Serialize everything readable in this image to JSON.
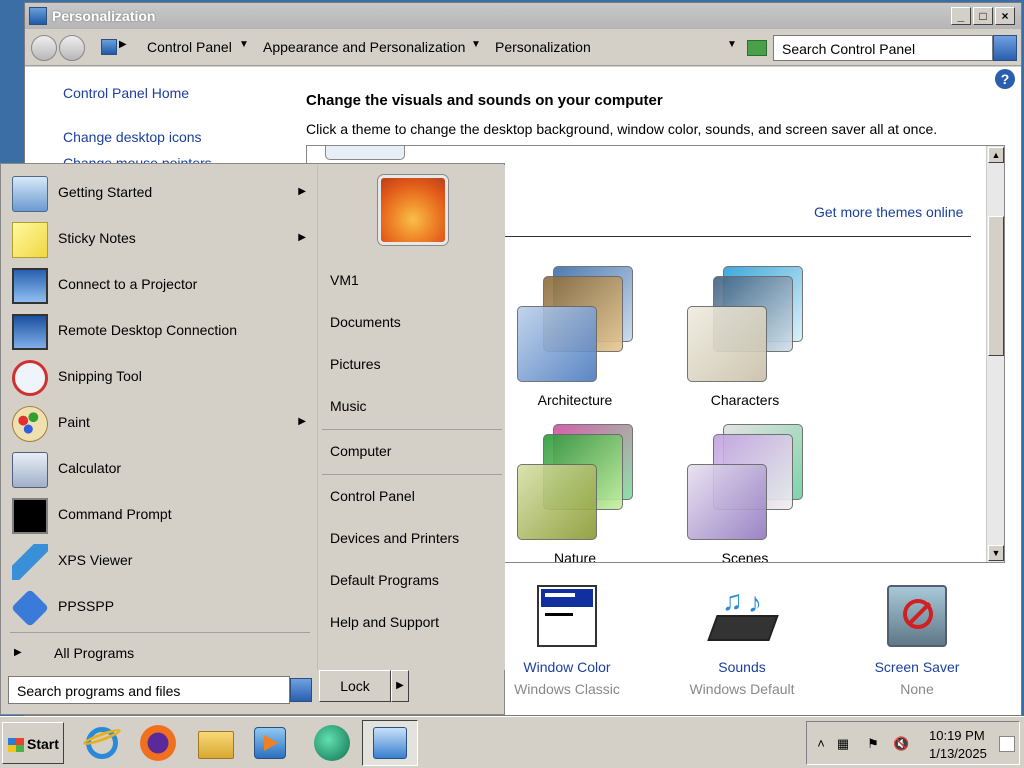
{
  "window": {
    "title": "Personalization",
    "controls": {
      "minimize": "_",
      "maximize": "□",
      "close": "×"
    }
  },
  "address": {
    "crumbs": [
      "Control Panel",
      "Appearance and Personalization",
      "Personalization"
    ],
    "search_placeholder": "Search Control Panel"
  },
  "sidebar": {
    "links": [
      "Control Panel Home",
      "Change desktop icons",
      "Change mouse pointers"
    ]
  },
  "main": {
    "title": "Change the visuals and sounds on your computer",
    "description": "Click a theme to change the desktop background, window color, sounds, and screen saver all at once.",
    "more_themes": "Get more themes online",
    "themes": [
      {
        "label": "Architecture"
      },
      {
        "label": "Characters"
      },
      {
        "label": "Nature"
      },
      {
        "label": "Scenes"
      }
    ],
    "bottom": [
      {
        "name": "Window Color",
        "sub": "Windows Classic",
        "icon": "window-color-icon"
      },
      {
        "name": "Sounds",
        "sub": "Windows Default",
        "icon": "sounds-icon"
      },
      {
        "name": "Screen Saver",
        "sub": "None",
        "icon": "screen-saver-icon"
      }
    ]
  },
  "startmenu": {
    "programs": [
      {
        "label": "Getting Started",
        "submenu": true,
        "icon": "getting-started-icon"
      },
      {
        "label": "Sticky Notes",
        "submenu": true,
        "icon": "sticky-notes-icon"
      },
      {
        "label": "Connect to a Projector",
        "submenu": false,
        "icon": "projector-icon"
      },
      {
        "label": "Remote Desktop Connection",
        "submenu": false,
        "icon": "remote-desktop-icon"
      },
      {
        "label": "Snipping Tool",
        "submenu": false,
        "icon": "snipping-tool-icon"
      },
      {
        "label": "Paint",
        "submenu": true,
        "icon": "paint-icon"
      },
      {
        "label": "Calculator",
        "submenu": false,
        "icon": "calculator-icon"
      },
      {
        "label": "Command Prompt",
        "submenu": false,
        "icon": "command-prompt-icon"
      },
      {
        "label": "XPS Viewer",
        "submenu": false,
        "icon": "xps-viewer-icon"
      },
      {
        "label": "PPSSPP",
        "submenu": false,
        "icon": "ppsspp-icon"
      }
    ],
    "all_programs": "All Programs",
    "search_placeholder": "Search programs and files",
    "right": {
      "group1": [
        "VM1",
        "Documents",
        "Pictures",
        "Music"
      ],
      "group2": [
        "Computer"
      ],
      "group3": [
        "Control Panel",
        "Devices and Printers",
        "Default Programs",
        "Help and Support"
      ]
    },
    "lock": "Lock"
  },
  "taskbar": {
    "start": "Start",
    "time": "10:19 PM",
    "date": "1/13/2025"
  }
}
